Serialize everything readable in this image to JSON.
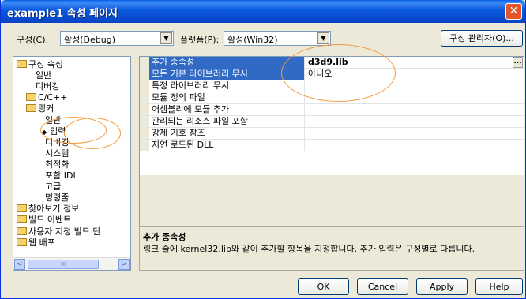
{
  "window": {
    "title": "example1 속성 페이지",
    "close": "✕"
  },
  "toolbar": {
    "config_label": "구성(C):",
    "config_value": "활성(Debug)",
    "platform_label": "플랫폼(P):",
    "platform_value": "활성(Win32)",
    "config_manager": "구성 관리자(O)..."
  },
  "tree": {
    "items": [
      {
        "label": "구성 속성",
        "folder": true
      },
      {
        "label": "일반",
        "folder": false
      },
      {
        "label": "디버깅",
        "folder": false
      },
      {
        "label": "C/C++",
        "folder": true
      },
      {
        "label": "링커",
        "folder": true
      },
      {
        "label": "일반",
        "folder": false
      },
      {
        "label": "입력",
        "folder": false,
        "marker": "◆"
      },
      {
        "label": "디버깅",
        "folder": false
      },
      {
        "label": "시스템",
        "folder": false
      },
      {
        "label": "최적화",
        "folder": false
      },
      {
        "label": "포함 IDL",
        "folder": false
      },
      {
        "label": "고급",
        "folder": false
      },
      {
        "label": "명령줄",
        "folder": false
      },
      {
        "label": "찾아보기 정보",
        "folder": true
      },
      {
        "label": "빌드 이벤트",
        "folder": true
      },
      {
        "label": "사용자 지정 빌드 단",
        "folder": true
      },
      {
        "label": "웹 배포",
        "folder": true
      }
    ],
    "scroll_left": "<",
    "scroll_right": ">",
    "scroll_thumb": "III"
  },
  "grid": {
    "rows": [
      {
        "name": "추가 종속성",
        "value": "d3d9.lib"
      },
      {
        "name": "모든 기본 라이브러리 무시",
        "value": "아니오"
      },
      {
        "name": "특정 라이브러리 무시",
        "value": ""
      },
      {
        "name": "모듈 정의 파일",
        "value": ""
      },
      {
        "name": "어셈블리에 모듈 추가",
        "value": ""
      },
      {
        "name": "관리되는 리소스 파일 포함",
        "value": ""
      },
      {
        "name": "강제 기호 참조",
        "value": ""
      },
      {
        "name": "지연 로드된 DLL",
        "value": ""
      }
    ],
    "ellipsis": "..."
  },
  "description": {
    "title": "추가 종속성",
    "text": "링크 줄에 kernel32.lib와 같이 추가할 항목을 지정합니다. 추가 입력은 구성별로 다릅니다."
  },
  "buttons": {
    "ok": "OK",
    "cancel": "Cancel",
    "apply": "Apply",
    "help": "Help"
  },
  "colors": {
    "titlebar": "#0a5fe8",
    "selection": "#316ac5",
    "annotation": "#f29a3a"
  }
}
